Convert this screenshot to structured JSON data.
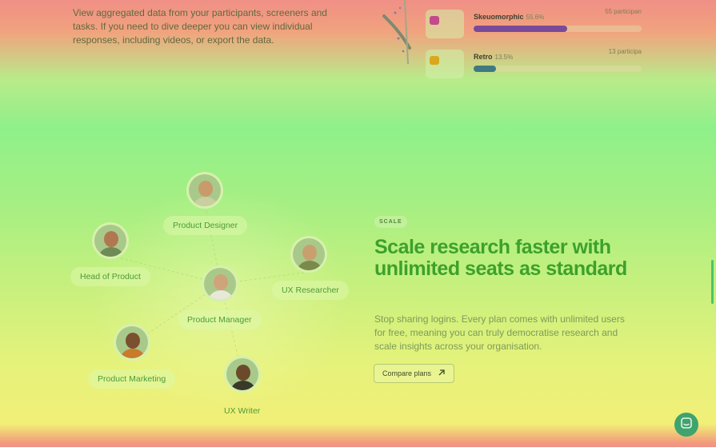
{
  "intro": {
    "text": "View aggregated data from your participants, screeners and tasks. If you need to dive deeper you can view individual responses, including videos, or export the data."
  },
  "poll": {
    "rows": [
      {
        "label": "Skeuomorphic",
        "percent": "55.6%",
        "count": "55 participan",
        "fill_fraction": 0.556,
        "color": "#7a4a9a",
        "icon": "image-icon",
        "icon_color": "#c4498a"
      },
      {
        "label": "Retro",
        "percent": "13.5%",
        "count": "13 participa",
        "fill_fraction": 0.135,
        "color": "#3f7a80",
        "icon": "image-icon",
        "icon_color": "#d9a81c"
      }
    ]
  },
  "team": {
    "roles": [
      {
        "id": "product-designer",
        "label": "Product Designer",
        "skin": "#c99a6a",
        "shirt": "#c9cfa0"
      },
      {
        "id": "head-of-product",
        "label": "Head of Product",
        "skin": "#b07850",
        "shirt": "#6f8a55"
      },
      {
        "id": "ux-researcher",
        "label": "UX Researcher",
        "skin": "#c8a070",
        "shirt": "#7a8a4a"
      },
      {
        "id": "product-manager",
        "label": "Product Manager",
        "skin": "#d0a47a",
        "shirt": "#e8e8d8"
      },
      {
        "id": "product-marketing",
        "label": "Product Marketing",
        "skin": "#7a5030",
        "shirt": "#c97a2a"
      },
      {
        "id": "ux-writer",
        "label": "UX Writer",
        "skin": "#6a4a2a",
        "shirt": "#3a3a2a"
      }
    ]
  },
  "scale": {
    "tag": "SCALE",
    "heading": "Scale research faster with unlimited seats as standard",
    "description": "Stop sharing logins. Every plan comes with unlimited users for free, meaning you can truly democratise research and scale insights across your organisation.",
    "button_label": "Compare plans",
    "button_icon": "arrow-up-right-icon"
  },
  "chat": {
    "icon": "chat-icon",
    "color": "#3fa36e"
  }
}
